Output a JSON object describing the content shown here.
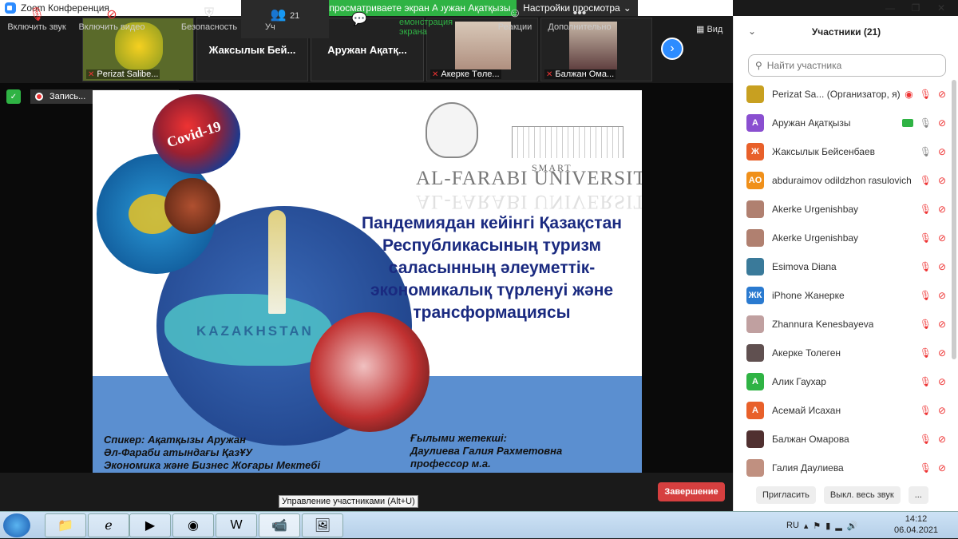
{
  "window": {
    "title": "Zoom Конференция",
    "sharing_banner": "Вы просматриваете экран Аружан Ақатқызы",
    "view_options": "Настройки просмотра"
  },
  "thumbnails": [
    {
      "name": "Perizat Salibe..."
    },
    {
      "name": "Жаксылык  Бей..."
    },
    {
      "name": "Аружан  Ақатқ..."
    },
    {
      "name": "Акерке Төле..."
    },
    {
      "name": "Балжан Ома..."
    }
  ],
  "view_button": "Вид",
  "recording": {
    "label": "Запись..."
  },
  "slide": {
    "logo_smart": "SMART",
    "logo_university": "AL-FARABI UNIVERSITY",
    "covid": "Covid-19",
    "kazakhstan": "KAZAKHSTAN",
    "title": "Пандемиядан кейінгі Қазақстан Республикасының туризм саласынның  әлеуметтік-экономикалық түрленуі және трансформациясы",
    "speaker_1": "Спикер: Ақатқызы Аружан",
    "speaker_2": "Әл-Фараби атындағы ҚазҰУ",
    "speaker_3": "Экономика және Бизнес Жоғары Мектебі",
    "advisor_1": "Ғылыми жетекші:",
    "advisor_2": "Даулиева Галия Рахметовна",
    "advisor_3": "профессор м.а."
  },
  "panel": {
    "title": "Участники (21)",
    "search_placeholder": "Найти участника",
    "participants": [
      {
        "initials": "",
        "name": "Perizat Sa...  (Организатор, я)",
        "color": "#c8a020"
      },
      {
        "initials": "А",
        "name": "Аружан Ақатқызы",
        "color": "#8a4fd0"
      },
      {
        "initials": "Ж",
        "name": "Жаксылык Бейсенбаев",
        "color": "#e8602a"
      },
      {
        "initials": "AO",
        "name": "abduraimov odildzhon rasulovich",
        "color": "#f0901a"
      },
      {
        "initials": "",
        "name": "Akerke Urgenishbay",
        "color": "#b08070"
      },
      {
        "initials": "",
        "name": "Akerke Urgenishbay",
        "color": "#b08070"
      },
      {
        "initials": "",
        "name": "Esimova Diana",
        "color": "#3a7a9a"
      },
      {
        "initials": "ЖК",
        "name": "iPhone Жанерке",
        "color": "#2a7ad0"
      },
      {
        "initials": "",
        "name": "Zhannura Kenesbayeva",
        "color": "#c0a0a0"
      },
      {
        "initials": "",
        "name": "Акерке Толеген",
        "color": "#605050"
      },
      {
        "initials": "А",
        "name": "Алик Гаухар",
        "color": "#2fb344"
      },
      {
        "initials": "А",
        "name": "Асемай Исахан",
        "color": "#e8602a"
      },
      {
        "initials": "",
        "name": "Балжан Омарова",
        "color": "#503030"
      },
      {
        "initials": "",
        "name": "Галия Даулиева",
        "color": "#c09080"
      }
    ],
    "invite": "Пригласить",
    "mute_all": "Выкл. весь звук",
    "more": "..."
  },
  "toolbar": {
    "audio": "Включить звук",
    "video": "Включить видео",
    "security": "Безопасность",
    "participants_count": "21",
    "participants": "Уч",
    "chat": "",
    "share": "емонстрация экрана",
    "reactions": "Реакции",
    "more": "Дополнительно",
    "end": "Завершение",
    "tooltip": "Управление участниками (Alt+U)"
  },
  "taskbar": {
    "lang": "RU",
    "time": "14:12",
    "date": "06.04.2021"
  }
}
